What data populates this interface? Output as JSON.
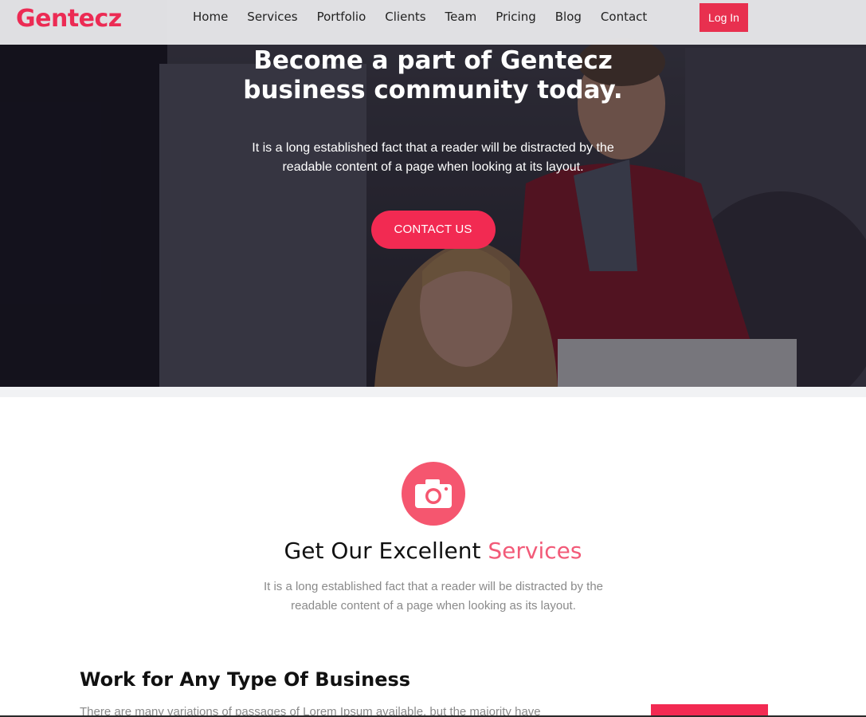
{
  "brand": {
    "logo_text": "Gentecz",
    "accent_color": "#ec2b54"
  },
  "nav": {
    "links": [
      "Home",
      "Services",
      "Portfolio",
      "Clients",
      "Team",
      "Pricing",
      "Blog",
      "Contact"
    ],
    "login_label": "Log In"
  },
  "hero": {
    "title": "Become a part of Gentecz business community today.",
    "text": "It is a long established fact that a reader will be distracted by the readable content of a page when looking at its layout.",
    "cta_label": "CONTACT US",
    "cta_color": "#f22a52"
  },
  "services": {
    "icon": "camera-icon",
    "icon_color": "#f5566f",
    "title_prefix": "Get Our Excellent",
    "title_accent": "Services",
    "text": "It is a long established fact that a reader will be distracted by the readable content of a page when looking as its layout."
  },
  "work": {
    "title": "Work for Any Type Of Business",
    "text": "There are many variations of passages of Lorem Ipsum available, but the majority have"
  }
}
